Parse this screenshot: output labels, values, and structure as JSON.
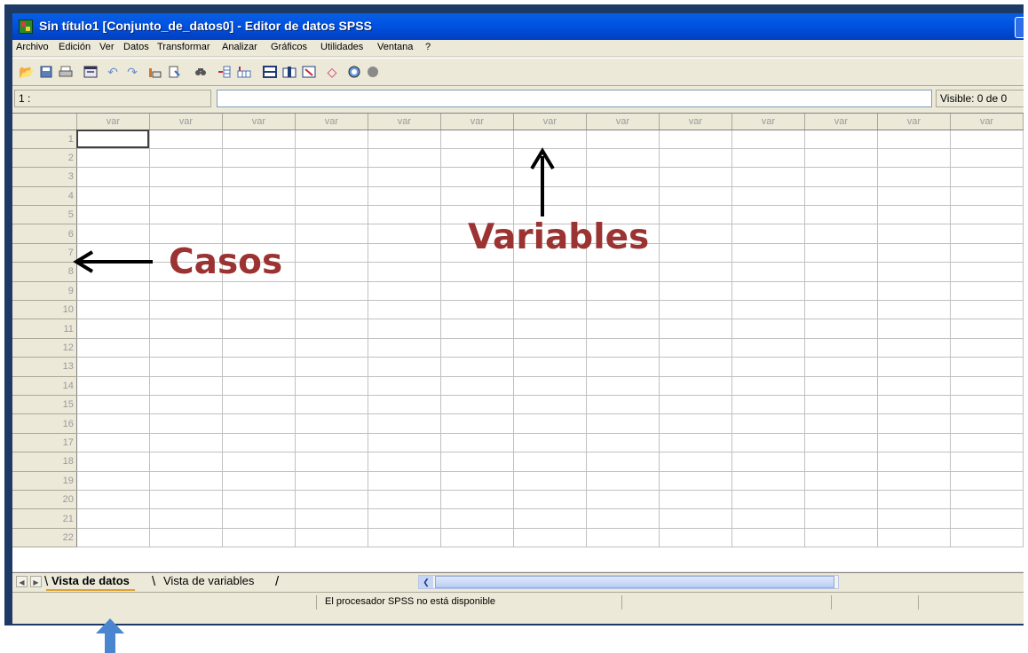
{
  "window": {
    "title": "Sin título1 [Conjunto_de_datos0] - Editor de datos SPSS"
  },
  "menubar": {
    "items": [
      "Archivo",
      "Edición",
      "Ver",
      "Datos",
      "Transformar",
      "Analizar",
      "Gráficos",
      "Utilidades",
      "Ventana",
      "?"
    ]
  },
  "toolbar": {
    "icons": [
      "open-folder-icon",
      "save-icon",
      "print-icon",
      "dialog-recall-icon",
      "undo-icon",
      "redo-icon",
      "goto-case-icon",
      "variables-icon",
      "find-icon",
      "insert-cases-icon",
      "insert-variable-icon",
      "split-file-icon",
      "weight-cases-icon",
      "select-cases-icon",
      "value-labels-icon",
      "use-sets-icon",
      "show-all-icon"
    ]
  },
  "cellbar": {
    "cell_ref": "1 :",
    "visible": "Visible: 0 de 0"
  },
  "grid": {
    "column_header": "var",
    "column_count": 13,
    "rows": [
      "1",
      "2",
      "3",
      "4",
      "5",
      "6",
      "7",
      "8",
      "9",
      "10",
      "11",
      "12",
      "13",
      "14",
      "15",
      "16",
      "17",
      "18",
      "19",
      "20",
      "21",
      "22"
    ]
  },
  "tabs": {
    "data_view": "Vista de datos",
    "variable_view": "Vista de variables"
  },
  "status": {
    "text": "El procesador SPSS no está disponible"
  },
  "annotations": {
    "variables": "Variables",
    "casos": "Casos",
    "text_color": "#9b3333",
    "arrow_black": "#000000",
    "arrow_blue": "#4a86d0"
  }
}
